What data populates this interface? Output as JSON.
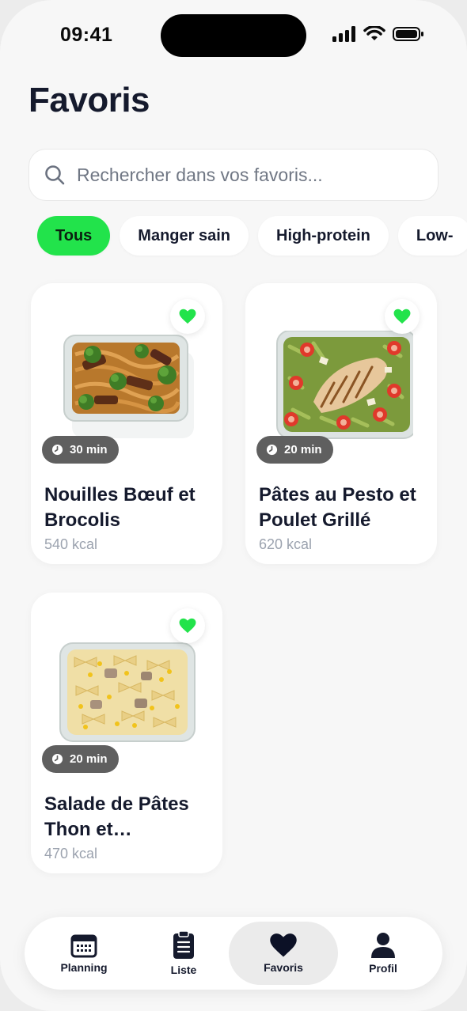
{
  "status_bar": {
    "time": "09:41"
  },
  "page": {
    "title": "Favoris"
  },
  "search": {
    "placeholder": "Rechercher dans vos favoris..."
  },
  "filters": [
    {
      "label": "Tous",
      "active": true
    },
    {
      "label": "Manger sain",
      "active": false
    },
    {
      "label": "High-protein",
      "active": false
    },
    {
      "label": "Low-",
      "active": false
    }
  ],
  "recipes": [
    {
      "title": "Nouilles Bœuf et Brocolis",
      "time": "30 min",
      "kcal": "540 kcal",
      "favorite": true,
      "image": "beef-noodles-broccoli"
    },
    {
      "title": "Pâtes au Pesto et Poulet Grillé",
      "time": "20 min",
      "kcal": "620 kcal",
      "favorite": true,
      "image": "pesto-pasta-chicken"
    },
    {
      "title": "Salade de Pâtes Thon et…",
      "time": "20 min",
      "kcal": "470 kcal",
      "favorite": true,
      "image": "tuna-pasta-salad"
    }
  ],
  "tabbar": [
    {
      "label": "Planning",
      "icon": "calendar-icon",
      "active": false
    },
    {
      "label": "Liste",
      "icon": "clipboard-icon",
      "active": false
    },
    {
      "label": "Favoris",
      "icon": "heart-icon",
      "active": true
    },
    {
      "label": "Profil",
      "icon": "user-icon",
      "active": false
    }
  ],
  "colors": {
    "accent": "#22e34b",
    "title": "#151a2d",
    "muted": "#9ca3af",
    "badge": "#5f5f5f"
  }
}
